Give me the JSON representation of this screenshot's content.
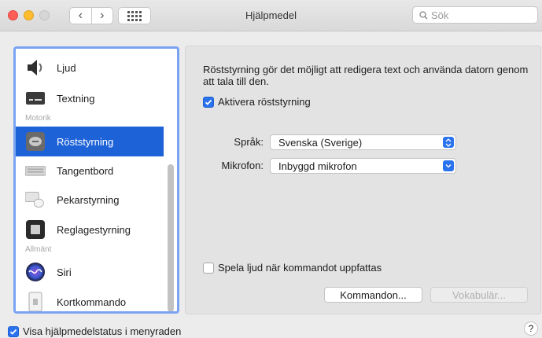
{
  "window": {
    "title": "Hjälpmedel"
  },
  "toolbar": {
    "back_glyph": "‹",
    "forward_glyph": "›"
  },
  "search": {
    "placeholder": "Sök"
  },
  "sidebar": {
    "sections": {
      "motorik": "Motorik",
      "allmant": "Allmänt"
    },
    "items": [
      {
        "label": "Ljud",
        "icon": "speaker-icon"
      },
      {
        "label": "Textning",
        "icon": "captions-icon"
      },
      {
        "label": "Röststyrning",
        "icon": "voice-control-icon",
        "selected": true
      },
      {
        "label": "Tangentbord",
        "icon": "keyboard-icon"
      },
      {
        "label": "Pekarstyrning",
        "icon": "pointer-icon"
      },
      {
        "label": "Reglagestyrning",
        "icon": "switch-control-icon"
      },
      {
        "label": "Siri",
        "icon": "siri-icon"
      },
      {
        "label": "Kortkommando",
        "icon": "shortcut-icon"
      }
    ]
  },
  "main": {
    "description": "Röststyrning gör det möjligt att redigera text och använda datorn genom att tala till den.",
    "enable_voice_control": {
      "label": "Aktivera röststyrning",
      "checked": true
    },
    "language": {
      "label": "Språk:",
      "value": "Svenska (Sverige)"
    },
    "microphone": {
      "label": "Mikrofon:",
      "value": "Inbyggd mikrofon"
    },
    "play_sound": {
      "label": "Spela ljud när kommandot uppfattas",
      "checked": false
    },
    "commands_button": "Kommandon...",
    "vocabulary_button": "Vokabulär..."
  },
  "footer": {
    "show_status": {
      "label": "Visa hjälpmedelstatus i menyraden",
      "checked": true
    },
    "help": "?"
  },
  "colors": {
    "accent": "#2b73ee",
    "selection": "#1e62d8"
  }
}
